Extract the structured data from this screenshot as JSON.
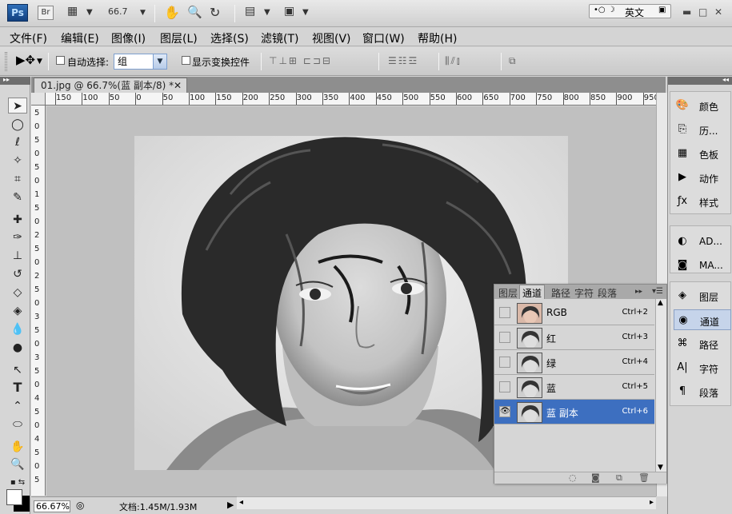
{
  "appbar": {
    "logo": "Ps",
    "bridge": "Br",
    "zoom": "66.7",
    "ime": {
      "label": "英文"
    },
    "icons": [
      "hand-icon",
      "zoom-icon",
      "rotate-view-icon",
      "arrange-icon",
      "screen-mode-icon"
    ]
  },
  "menu": [
    "文件(F)",
    "编辑(E)",
    "图像(I)",
    "图层(L)",
    "选择(S)",
    "滤镜(T)",
    "视图(V)",
    "窗口(W)",
    "帮助(H)"
  ],
  "options": {
    "auto_select_label": "自动选择:",
    "auto_select_value": "组",
    "show_transform_label": "显示变换控件"
  },
  "document": {
    "tab_title": "01.jpg @ 66.7%(蓝 副本/8) *",
    "zoom": "66.67%",
    "doc_info": "文档:1.45M/1.93M",
    "ruler_h": [
      "150",
      "100",
      "50",
      "0",
      "50",
      "100",
      "150",
      "200",
      "250",
      "300",
      "350",
      "400",
      "450",
      "500",
      "550",
      "600",
      "650",
      "700",
      "750",
      "800",
      "850",
      "900",
      "950"
    ],
    "ruler_v": [
      "5",
      "0",
      "5",
      "0",
      "5",
      "0",
      "1",
      "5",
      "0",
      "2",
      "5",
      "0",
      "2",
      "5",
      "0",
      "3",
      "5",
      "0",
      "3",
      "5",
      "0",
      "4",
      "5",
      "0",
      "4",
      "5",
      "0",
      "5"
    ]
  },
  "channels_panel": {
    "tabs": [
      "图层",
      "通道",
      "路径",
      "字符",
      "段落"
    ],
    "active_tab": "通道",
    "rows": [
      {
        "name": "RGB",
        "shortcut": "Ctrl+2",
        "visible": false
      },
      {
        "name": "红",
        "shortcut": "Ctrl+3",
        "visible": false
      },
      {
        "name": "绿",
        "shortcut": "Ctrl+4",
        "visible": false
      },
      {
        "name": "蓝",
        "shortcut": "Ctrl+5",
        "visible": false
      },
      {
        "name": "蓝 副本",
        "shortcut": "Ctrl+6",
        "visible": true
      }
    ],
    "selection_color": "#3d6fc0"
  },
  "dock": {
    "group1": [
      {
        "label": "颜色",
        "icon": "color-icon"
      },
      {
        "label": "历...",
        "icon": "history-icon"
      },
      {
        "label": "色板",
        "icon": "swatches-icon"
      },
      {
        "label": "动作",
        "icon": "actions-icon"
      },
      {
        "label": "样式",
        "icon": "styles-icon"
      }
    ],
    "group2": [
      {
        "label": "AD...",
        "icon": "adjustments-icon"
      },
      {
        "label": "MA...",
        "icon": "masks-icon"
      }
    ],
    "group3": [
      {
        "label": "图层",
        "icon": "layers-icon"
      },
      {
        "label": "通道",
        "icon": "channels-icon"
      },
      {
        "label": "路径",
        "icon": "paths-icon"
      },
      {
        "label": "字符",
        "icon": "character-icon"
      },
      {
        "label": "段落",
        "icon": "paragraph-icon"
      }
    ],
    "active": "通道"
  }
}
